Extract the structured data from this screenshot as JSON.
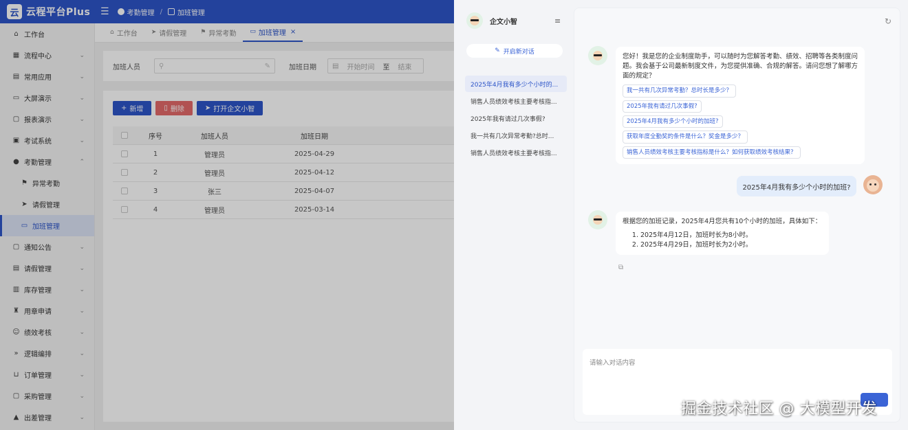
{
  "app": {
    "title": "云程平台Plus",
    "logo_letter": "云"
  },
  "breadcrumb": [
    "考勤管理",
    "加班管理"
  ],
  "sidebar": {
    "items": [
      {
        "label": "工作台",
        "icon": "home-icon",
        "arrow": ""
      },
      {
        "label": "流程中心",
        "icon": "grid-icon",
        "arrow": "⌄"
      },
      {
        "label": "常用应用",
        "icon": "app-icon",
        "arrow": "⌄"
      },
      {
        "label": "大屏演示",
        "icon": "monitor-icon",
        "arrow": "⌄"
      },
      {
        "label": "报表演示",
        "icon": "report-icon",
        "arrow": "⌄"
      },
      {
        "label": "考试系统",
        "icon": "exam-icon",
        "arrow": "⌄"
      },
      {
        "label": "考勤管理",
        "icon": "check-icon",
        "arrow": "⌃"
      },
      {
        "label": "异常考勤",
        "icon": "flag-icon",
        "arrow": ""
      },
      {
        "label": "请假管理",
        "icon": "send-icon",
        "arrow": ""
      },
      {
        "label": "加班管理",
        "icon": "monitor-icon",
        "arrow": ""
      },
      {
        "label": "通知公告",
        "icon": "notice-icon",
        "arrow": "⌄"
      },
      {
        "label": "请假管理",
        "icon": "leave-icon",
        "arrow": "⌄"
      },
      {
        "label": "库存管理",
        "icon": "stock-icon",
        "arrow": "⌄"
      },
      {
        "label": "用章申请",
        "icon": "seal-icon",
        "arrow": "⌄"
      },
      {
        "label": "绩效考核",
        "icon": "user-icon",
        "arrow": "⌄"
      },
      {
        "label": "逻辑编排",
        "icon": "flow-icon",
        "arrow": "⌄"
      },
      {
        "label": "订单管理",
        "icon": "cart-icon",
        "arrow": "⌄"
      },
      {
        "label": "采购管理",
        "icon": "purchase-icon",
        "arrow": "⌄"
      },
      {
        "label": "出差管理",
        "icon": "trip-icon",
        "arrow": "⌄"
      }
    ]
  },
  "tabs": [
    {
      "label": "工作台",
      "icon": "⌂",
      "active": false
    },
    {
      "label": "请假管理",
      "icon": "➤",
      "active": false
    },
    {
      "label": "异常考勤",
      "icon": "⚑",
      "active": false
    },
    {
      "label": "加班管理",
      "icon": "▭",
      "active": true,
      "close": "×"
    }
  ],
  "filter": {
    "person_label": "加班人员",
    "date_label": "加班日期",
    "start_placeholder": "开始时间",
    "to": "至",
    "end_placeholder": "结束"
  },
  "toolbar": {
    "add": "新增",
    "delete": "删除",
    "open_assistant": "打开企文小智"
  },
  "table": {
    "headers": [
      "序号",
      "加班人员",
      "加班日期"
    ],
    "rows": [
      {
        "idx": "1",
        "name": "管理员",
        "date": "2025-04-29"
      },
      {
        "idx": "2",
        "name": "管理员",
        "date": "2025-04-12"
      },
      {
        "idx": "3",
        "name": "张三",
        "date": "2025-04-07"
      },
      {
        "idx": "4",
        "name": "管理员",
        "date": "2025-03-14"
      }
    ]
  },
  "chat": {
    "assistant_name": "企文小智",
    "new_chat": "开启新对话",
    "history": [
      "2025年4月我有多少个小时的...",
      "销售人员绩效考核主要考核指...",
      "2025年我有请过几次事假?",
      "我一共有几次异常考勤?总时...",
      "销售人员绩效考核主要考核指..."
    ],
    "greeting": "您好！我是您的企业制度助手，可以随时为您解答考勤、绩效、招聘等各类制度问题。我会基于公司最新制度文件，为您提供准确、合规的解答。请问您想了解哪方面的规定？",
    "suggestions": [
      "我一共有几次异常考勤？总时长是多少？",
      "2025年我有请过几次事假?",
      "2025年4月我有多少个小时的加班?",
      "获取年度全勤奖的条件是什么？奖金是多少？",
      "销售人员绩效考核主要考核指标是什么？如何获取绩效考核结果？"
    ],
    "user_message": "2025年4月我有多少个小时的加班?",
    "answer_intro": "根据您的加班记录，2025年4月您共有10个小时的加班，具体如下：",
    "answer_items": [
      "2025年4月12日，加班时长为8小时。",
      "2025年4月29日，加班时长为2小时。"
    ],
    "input_placeholder": "请输入对话内容"
  },
  "watermark": "掘金技术社区 @ 大模型开发",
  "colors": {
    "primary": "#2d55c8",
    "danger": "#e05a5a",
    "chat_bg": "#f3f4f7"
  }
}
